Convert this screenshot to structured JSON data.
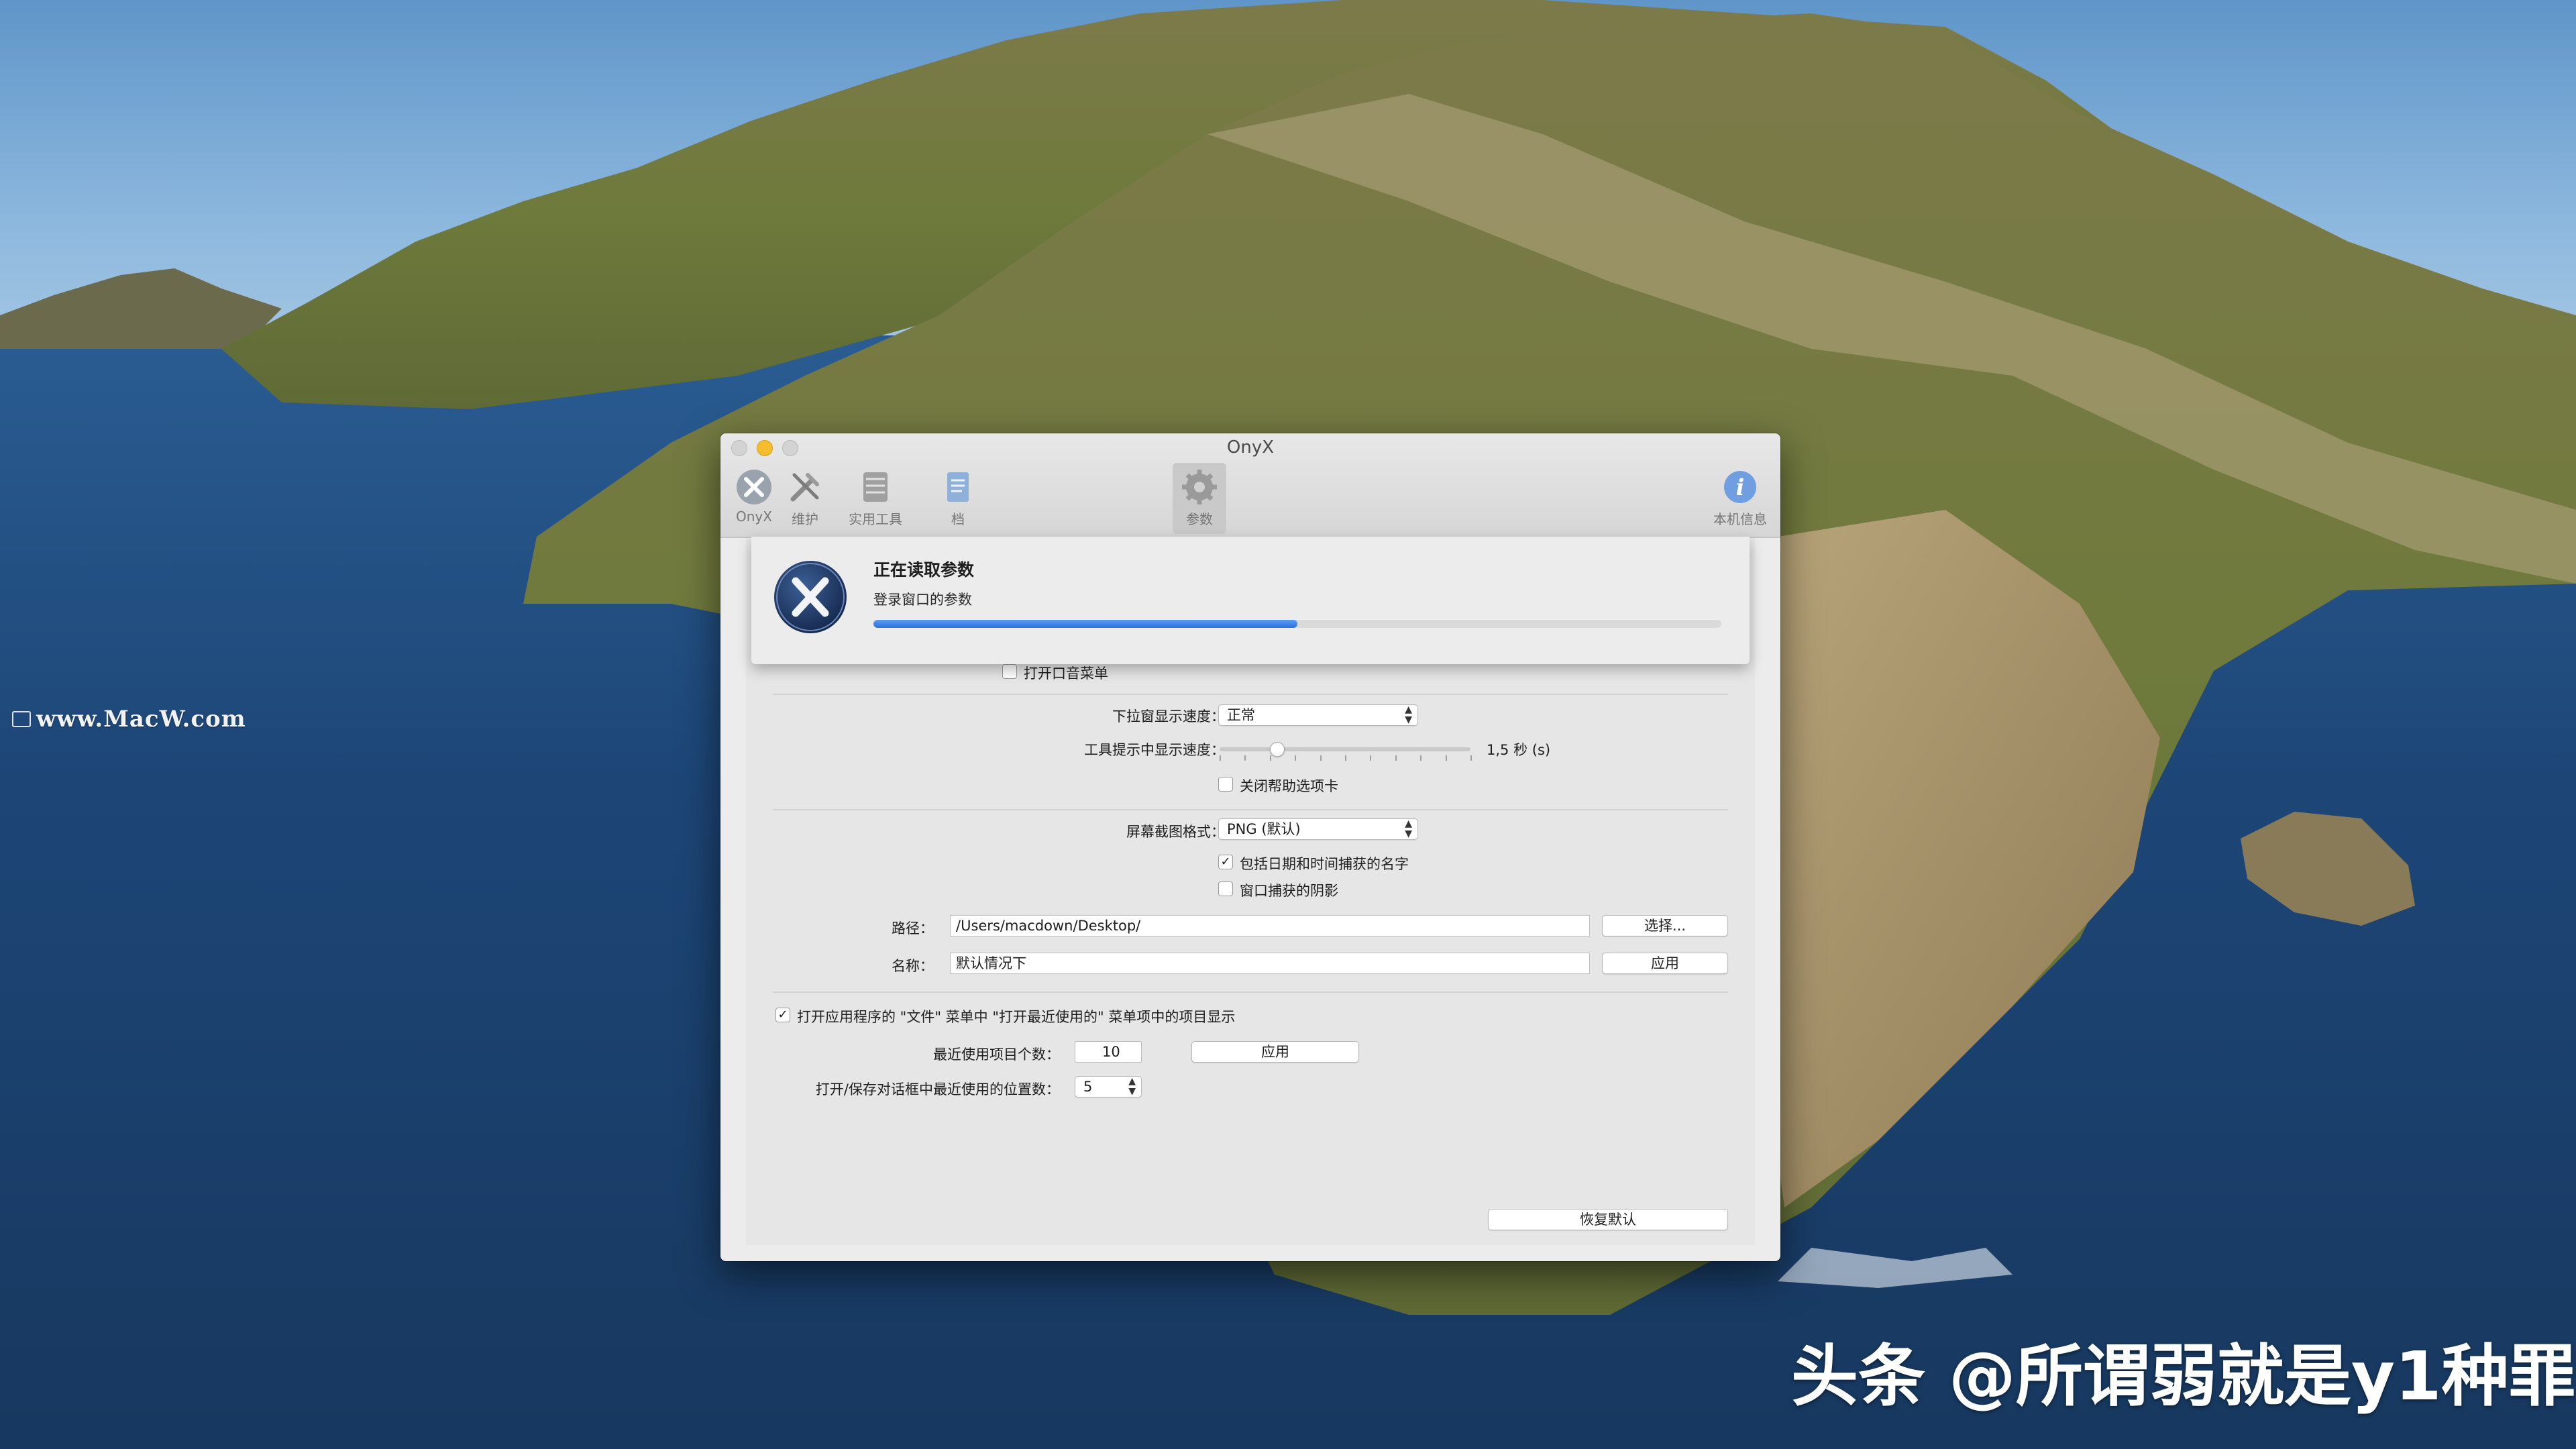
{
  "window": {
    "title": "OnyX"
  },
  "toolbar": {
    "items": [
      {
        "label": "OnyX",
        "icon": "onyx-logo-icon"
      },
      {
        "label": "维护",
        "icon": "tools-icon"
      },
      {
        "label": "实用工具",
        "icon": "utilities-icon"
      },
      {
        "label": "档",
        "icon": "document-icon"
      },
      {
        "label": "参数",
        "icon": "gear-icon",
        "active": true
      },
      {
        "label": "本机信息",
        "icon": "info-icon"
      }
    ]
  },
  "progress_sheet": {
    "title": "正在读取参数",
    "subtitle": "登录窗口的参数",
    "progress": 0.5
  },
  "prefs": {
    "open_sound_menu": {
      "label": "打开口音菜单",
      "checked": false
    },
    "dropdown_speed": {
      "label": "下拉窗显示速度：",
      "value": "正常"
    },
    "tooltip_speed": {
      "label": "工具提示中显示速度：",
      "value_text": "1,5 秒 (s)",
      "level": 0.23
    },
    "close_help_tabs": {
      "label": "关闭帮助选项卡",
      "checked": false
    },
    "screenshot_format": {
      "label": "屏幕截图格式：",
      "value": "PNG (默认)"
    },
    "include_datetime": {
      "label": "包括日期和时间捕获的名字",
      "checked": true
    },
    "window_shadow": {
      "label": "窗口捕获的阴影",
      "checked": false
    },
    "path": {
      "label": "路径：",
      "value": "/Users/macdown/Desktop/",
      "button": "选择..."
    },
    "name": {
      "label": "名称：",
      "value": "默认情况下",
      "button": "应用"
    },
    "recent_items_display": {
      "label": "打开应用程序的 \"文件\" 菜单中 \"打开最近使用的\" 菜单项中的项目显示",
      "checked": true
    },
    "recent_items_count": {
      "label": "最近使用项目个数：",
      "value": "10",
      "button": "应用"
    },
    "recent_locations": {
      "label": "打开/保存对话框中最近使用的位置数：",
      "value": "5"
    },
    "restore_defaults": "恢复默认"
  },
  "desktop": {
    "watermark_site": "www.MacW.com",
    "watermark_author": "头条 @所谓弱就是y1种罪"
  },
  "colors": {
    "accent": "#2c71e0",
    "minimize": "#f5bd2e"
  }
}
